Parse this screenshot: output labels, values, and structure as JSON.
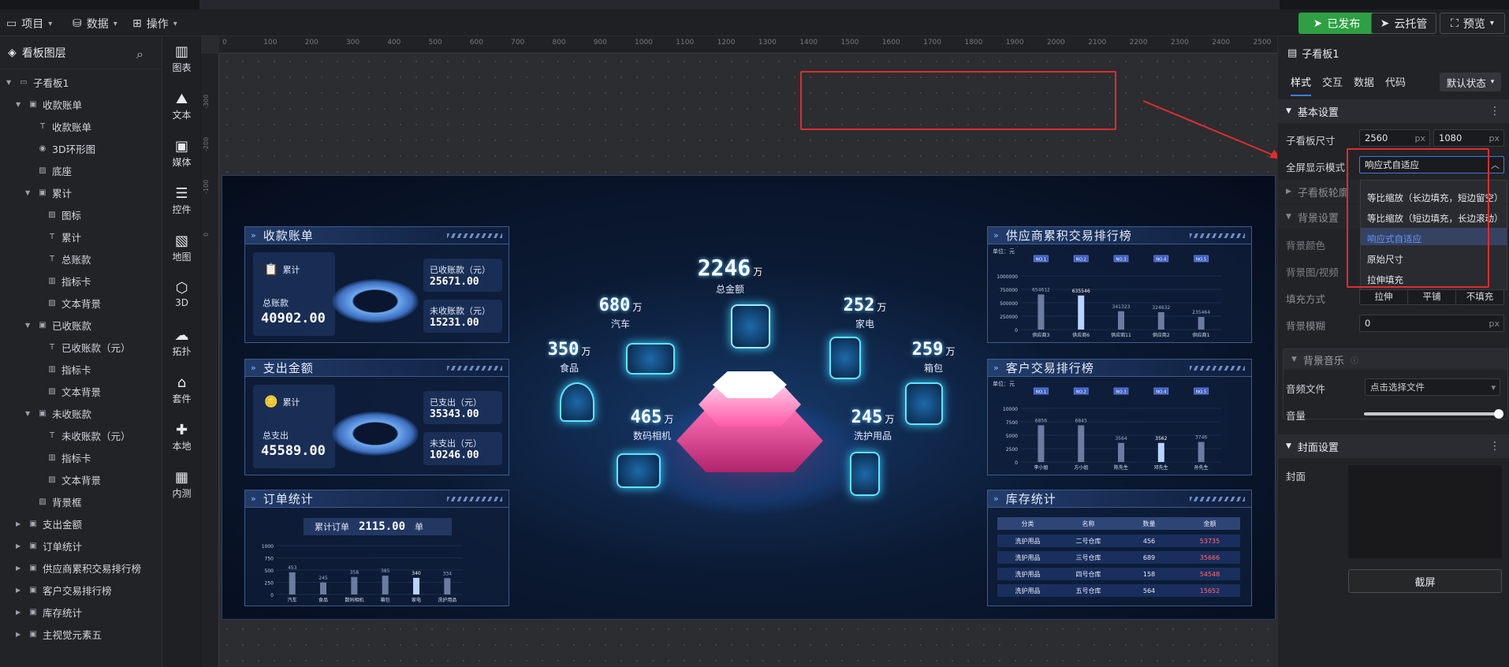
{
  "toolbar": {
    "menus": [
      {
        "label": "项目",
        "icon": "monitor-icon"
      },
      {
        "label": "数据",
        "icon": "database-icon"
      },
      {
        "label": "操作",
        "icon": "grid-icon"
      }
    ],
    "publish_label": "已发布",
    "cloud_label": "云托管",
    "preview_label": "预览"
  },
  "layers": {
    "title": "看板图层",
    "items": [
      {
        "label": "子看板1",
        "level": 0,
        "expand": "down",
        "icon": "monitor-icon"
      },
      {
        "label": "收款账单",
        "level": 1,
        "expand": "down",
        "icon": "group-icon"
      },
      {
        "label": "收款账单",
        "level": 2,
        "expand": "",
        "icon": "text-icon"
      },
      {
        "label": "3D环形图",
        "level": 2,
        "expand": "",
        "icon": "eye-icon"
      },
      {
        "label": "底座",
        "level": 2,
        "expand": "",
        "icon": "image-icon"
      },
      {
        "label": "累计",
        "level": 2,
        "expand": "down",
        "icon": "group-icon"
      },
      {
        "label": "图标",
        "level": 3,
        "expand": "",
        "icon": "image-icon"
      },
      {
        "label": "累计",
        "level": 3,
        "expand": "",
        "icon": "text-icon"
      },
      {
        "label": "总账款",
        "level": 3,
        "expand": "",
        "icon": "text-icon"
      },
      {
        "label": "指标卡",
        "level": 3,
        "expand": "",
        "icon": "card-icon"
      },
      {
        "label": "文本背景",
        "level": 3,
        "expand": "",
        "icon": "image-icon"
      },
      {
        "label": "已收账款",
        "level": 2,
        "expand": "down",
        "icon": "group-icon"
      },
      {
        "label": "已收账款（元）",
        "level": 3,
        "expand": "",
        "icon": "text-icon"
      },
      {
        "label": "指标卡",
        "level": 3,
        "expand": "",
        "icon": "card-icon"
      },
      {
        "label": "文本背景",
        "level": 3,
        "expand": "",
        "icon": "image-icon"
      },
      {
        "label": "未收账款",
        "level": 2,
        "expand": "down",
        "icon": "group-icon"
      },
      {
        "label": "未收账款（元）",
        "level": 3,
        "expand": "",
        "icon": "text-icon"
      },
      {
        "label": "指标卡",
        "level": 3,
        "expand": "",
        "icon": "card-icon"
      },
      {
        "label": "文本背景",
        "level": 3,
        "expand": "",
        "icon": "image-icon"
      },
      {
        "label": "背景框",
        "level": 2,
        "expand": "",
        "icon": "image-icon"
      },
      {
        "label": "支出金额",
        "level": 1,
        "expand": "right",
        "icon": "group-icon"
      },
      {
        "label": "订单统计",
        "level": 1,
        "expand": "right",
        "icon": "group-icon"
      },
      {
        "label": "供应商累积交易排行榜",
        "level": 1,
        "expand": "right",
        "icon": "group-icon"
      },
      {
        "label": "客户交易排行榜",
        "level": 1,
        "expand": "right",
        "icon": "group-icon"
      },
      {
        "label": "库存统计",
        "level": 1,
        "expand": "right",
        "icon": "group-icon"
      },
      {
        "label": "主视觉元素五",
        "level": 1,
        "expand": "right",
        "icon": "group-icon"
      }
    ]
  },
  "rail": [
    {
      "label": "图表",
      "icon": "chart-icon"
    },
    {
      "label": "文本",
      "icon": "text-icon"
    },
    {
      "label": "媒体",
      "icon": "media-icon"
    },
    {
      "label": "控件",
      "icon": "widget-icon"
    },
    {
      "label": "地图",
      "icon": "map-icon"
    },
    {
      "label": "3D",
      "icon": "cube-icon"
    },
    {
      "label": "拓扑",
      "icon": "topology-icon"
    },
    {
      "label": "套件",
      "icon": "kit-icon"
    },
    {
      "label": "本地",
      "icon": "puzzle-icon"
    },
    {
      "label": "内测",
      "icon": "beta-icon"
    }
  ],
  "ruler": {
    "top": [
      "0",
      "100",
      "200",
      "300",
      "400",
      "500",
      "600",
      "700",
      "800",
      "900",
      "1000",
      "1100",
      "1200",
      "1300",
      "1400",
      "1500",
      "1600",
      "1700",
      "1800",
      "1900",
      "2000",
      "2100",
      "2200",
      "2300",
      "2400",
      "2500"
    ],
    "left": [
      "-300",
      "-200",
      "-100",
      "0"
    ]
  },
  "dashboard": {
    "receipt": {
      "title": "收款账单",
      "cum": "累计",
      "total_label": "总账款",
      "total": "40902.00",
      "received_label": "已收账款（元）",
      "received": "25671.00",
      "unreceived_label": "未收账款（元）",
      "unreceived": "15231.00"
    },
    "expense": {
      "title": "支出金额",
      "cum": "累计",
      "total_label": "总支出",
      "total": "45589.00",
      "paid_label": "已支出（元）",
      "paid": "35343.00",
      "unpaid_label": "未支出（元）",
      "unpaid": "10246.00"
    },
    "orders": {
      "title": "订单统计",
      "cum_label": "累计订单",
      "cum_value": "2115.00",
      "unit": "单"
    },
    "center": {
      "total_value": "2246",
      "total_unit": "万",
      "total_label": "总金额",
      "metrics": [
        {
          "value": "680",
          "unit": "万",
          "label": "汽车"
        },
        {
          "value": "252",
          "unit": "万",
          "label": "家电"
        },
        {
          "value": "350",
          "unit": "万",
          "label": "食品"
        },
        {
          "value": "259",
          "unit": "万",
          "label": "箱包"
        },
        {
          "value": "465",
          "unit": "万",
          "label": "数码相机"
        },
        {
          "value": "245",
          "unit": "万",
          "label": "洗护用品"
        }
      ]
    },
    "supplier": {
      "title": "供应商累积交易排行榜",
      "unit": "单位：元"
    },
    "customer": {
      "title": "客户交易排行榜",
      "unit": "单位：元"
    },
    "stock": {
      "title": "库存统计",
      "headers": [
        "分类",
        "名称",
        "数量",
        "金额"
      ],
      "rows": [
        [
          "洗护用品",
          "二号仓库",
          "456",
          "53735"
        ],
        [
          "洗护用品",
          "三号仓库",
          "689",
          "35666"
        ],
        [
          "洗护用品",
          "四号仓库",
          "158",
          "54548"
        ],
        [
          "洗护用品",
          "五号仓库",
          "564",
          "15652"
        ]
      ]
    }
  },
  "chart_data": [
    {
      "type": "bar",
      "title": "订单统计",
      "categories": [
        "汽车",
        "食品",
        "数码相机",
        "箱包",
        "家电",
        "洗护用品"
      ],
      "values": [
        453,
        245,
        358,
        385,
        340,
        334
      ],
      "ylim": [
        0,
        1000
      ],
      "yticks": [
        "1000",
        "750",
        "500",
        "250",
        "0"
      ]
    },
    {
      "type": "bar",
      "title": "供应商累积交易排行榜",
      "ylabel": "单位：元",
      "categories": [
        "供应商3",
        "供应商6",
        "供应商11",
        "供应商2",
        "供应商1"
      ],
      "ranks": [
        "NO.1",
        "NO.2",
        "NO.3",
        "NO.4",
        "NO.5"
      ],
      "values": [
        654612,
        635546,
        341323,
        324632,
        235464
      ],
      "ylim": [
        0,
        1000000
      ],
      "yticks": [
        "1000000",
        "750000",
        "500000",
        "250000",
        "0"
      ]
    },
    {
      "type": "bar",
      "title": "客户交易排行榜",
      "ylabel": "单位：元",
      "categories": [
        "李小姐",
        "方小姐",
        "陈先生",
        "邓先生",
        "孙先生"
      ],
      "ranks": [
        "NO.1",
        "NO.2",
        "NO.3",
        "NO.4",
        "NO.5"
      ],
      "values": [
        6856,
        6845,
        3564,
        3562,
        3746
      ],
      "ylim": [
        0,
        10000
      ],
      "yticks": [
        "10000",
        "7500",
        "5000",
        "2500",
        "0"
      ]
    }
  ],
  "props": {
    "title": "子看板1",
    "tabs": [
      "样式",
      "交互",
      "数据",
      "代码"
    ],
    "state_label": "默认状态",
    "basic_section": "基本设置",
    "size_label": "子看板尺寸",
    "width": "2560",
    "height": "1080",
    "unit_px": "px",
    "fullscreen_label": "全屏显示模式",
    "fullscreen_value": "响应式自适应",
    "outline_label": "子看板轮廓",
    "bg_section": "背景设置",
    "bg_color_label": "背景颜色",
    "bg_image_label": "背景图/视频",
    "fill_label": "填充方式",
    "fill_options": [
      "拉伸",
      "平铺",
      "不填充"
    ],
    "blur_label": "背景模糊",
    "blur_value": "0",
    "music_section": "背景音乐",
    "audio_label": "音频文件",
    "audio_placeholder": "点击选择文件",
    "volume_label": "音量",
    "volume_level": 1.0,
    "cover_section": "封面设置",
    "cover_label": "封面",
    "screenshot_label": "截屏",
    "dropdown_options": [
      "等比缩放（长边填充，短边留空）",
      "等比缩放（短边填充，长边滚动）",
      "响应式自适应",
      "原始尺寸",
      "拉伸填充"
    ],
    "dropdown_selected": 2
  },
  "colors": {
    "accent": "#3b7ddd",
    "publish": "#2ea043",
    "highlight": "#e02d2d",
    "dash_bg": "#0b1a33",
    "neon_pink": "#ff4fa3",
    "neon_cyan": "#5ee6ff"
  }
}
